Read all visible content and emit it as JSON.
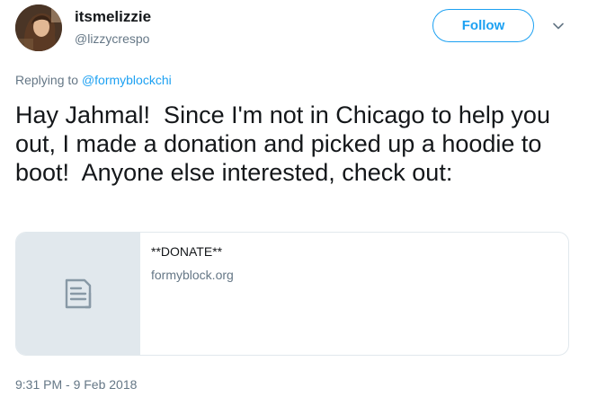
{
  "author": {
    "display_name": "itsmelizzie",
    "handle": "@lizzycrespo"
  },
  "follow_label": "Follow",
  "reply": {
    "prefix": "Replying to ",
    "handle": "@formyblockchi"
  },
  "tweet_text": "Hay Jahmal!  Since I'm not in Chicago to help you out, I made a donation and picked up a hoodie to boot!  Anyone else interested, check out:",
  "card": {
    "title": "**DONATE**",
    "domain": "formyblock.org",
    "icon": "document-icon"
  },
  "timestamp": "9:31 PM - 9 Feb 2018",
  "colors": {
    "accent": "#1da1f2",
    "text": "#14171a",
    "secondary": "#657786",
    "border": "#e1e8ed"
  }
}
